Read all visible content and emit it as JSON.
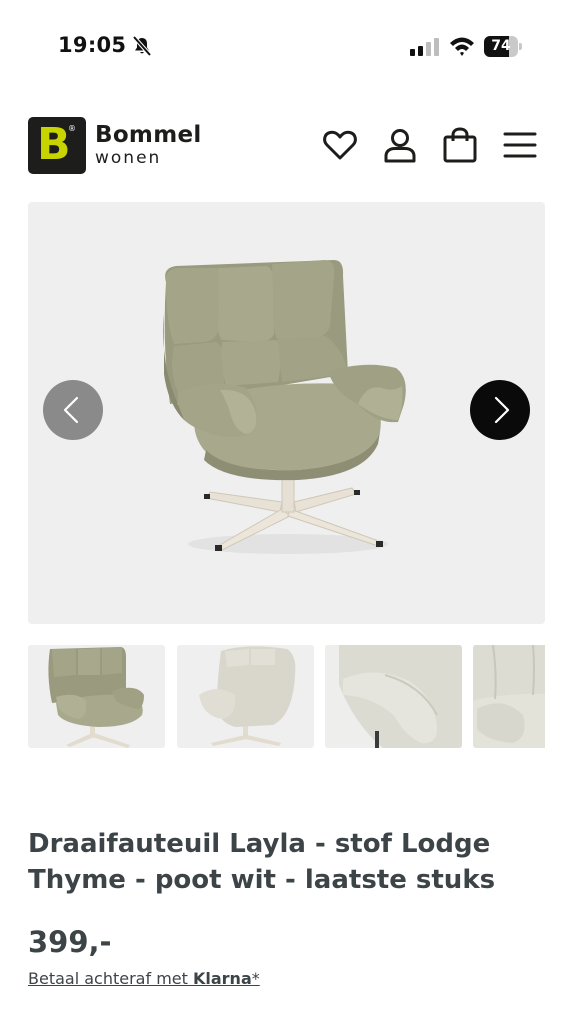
{
  "status_bar": {
    "time": "19:05",
    "battery_level": "74",
    "battery_fraction": 0.74,
    "icons": [
      "bell-slash-icon",
      "cellular-signal-icon",
      "wifi-icon",
      "battery-icon"
    ]
  },
  "header": {
    "logo_letter": "B",
    "logo_reg": "®",
    "brand_name": "Bommel",
    "brand_sub": "wonen",
    "icons": [
      "heart-icon",
      "user-icon",
      "shopping-bag-icon",
      "menu-icon"
    ]
  },
  "gallery": {
    "prev_icon": "chevron-left-icon",
    "next_icon": "chevron-right-icon",
    "thumbnail_count": 4
  },
  "product": {
    "title": "Draaifauteuil Layla - stof Lodge Thyme - poot wit - laatste stuks",
    "price": "399,-",
    "klarna_prefix": "Betaal achteraf met ",
    "klarna_brand": "Klarna",
    "klarna_suffix": "*"
  },
  "colors": {
    "brand_yellow": "#c8d400",
    "logo_bg": "#1d1d1b",
    "text": "#3d4448",
    "gallery_bg": "#efefef",
    "chair_fabric": "#9a9a7f"
  }
}
